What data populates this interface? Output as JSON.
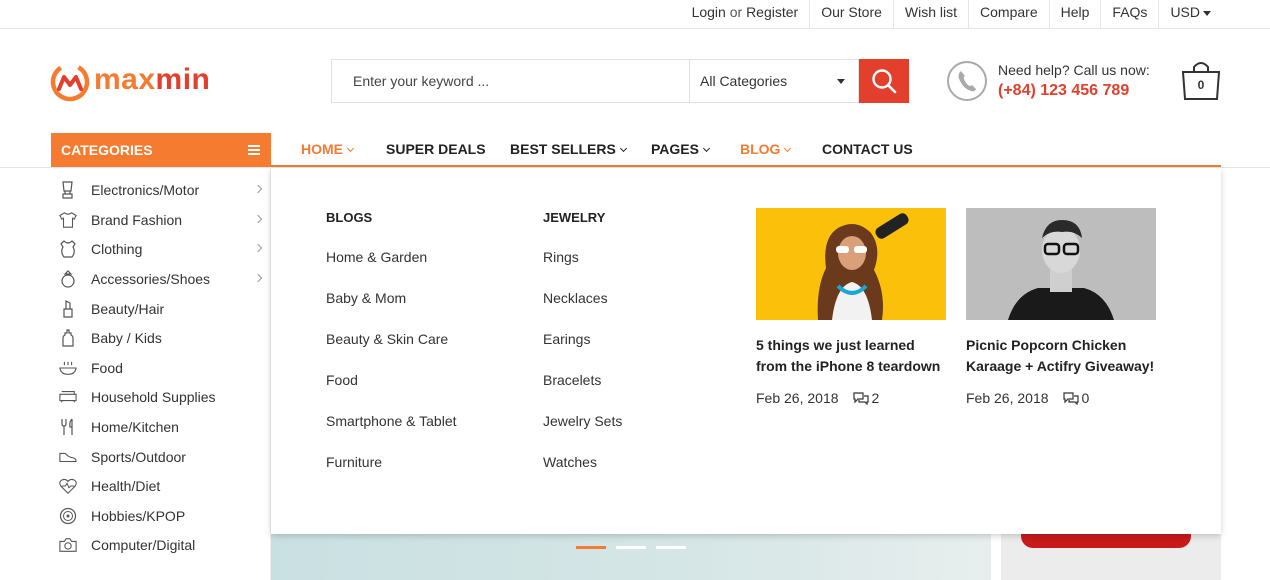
{
  "topbar": {
    "login": "Login",
    "or": "or",
    "register": "Register",
    "links": [
      "Our Store",
      "Wish list",
      "Compare",
      "Help",
      "FAQs"
    ],
    "currency": "USD"
  },
  "brand": {
    "part1": "max",
    "part2": "min",
    "primary_color": "#f47b30",
    "accent_color": "#e23f2d"
  },
  "search": {
    "placeholder": "Enter your keyword ...",
    "category": "All Categories"
  },
  "help": {
    "line1": "Need help? Call us now:",
    "phone": "(+84) 123 456 789"
  },
  "cart": {
    "count": "0"
  },
  "categories_label": "CATEGORIES",
  "menu": [
    {
      "label": "HOME",
      "active": true,
      "has_submenu": true
    },
    {
      "label": "SUPER DEALS",
      "active": false,
      "has_submenu": false
    },
    {
      "label": "BEST SELLERS",
      "active": false,
      "has_submenu": true
    },
    {
      "label": "PAGES",
      "active": false,
      "has_submenu": true
    },
    {
      "label": "BLOG",
      "active": true,
      "has_submenu": true
    },
    {
      "label": "CONTACT US",
      "active": false,
      "has_submenu": false
    }
  ],
  "sidebar": [
    {
      "label": "Electronics/Motor",
      "icon": "blender-icon",
      "has_sub": true
    },
    {
      "label": "Brand Fashion",
      "icon": "shirt-icon",
      "has_sub": true
    },
    {
      "label": "Clothing",
      "icon": "bodysuit-icon",
      "has_sub": true
    },
    {
      "label": "Accessories/Shoes",
      "icon": "ring-icon",
      "has_sub": true
    },
    {
      "label": "Beauty/Hair",
      "icon": "lipstick-icon",
      "has_sub": false
    },
    {
      "label": "Baby / Kids",
      "icon": "baby-bottle-icon",
      "has_sub": false
    },
    {
      "label": "Food",
      "icon": "food-bowl-icon",
      "has_sub": false
    },
    {
      "label": "Household Supplies",
      "icon": "sofa-icon",
      "has_sub": false
    },
    {
      "label": "Home/Kitchen",
      "icon": "utensils-icon",
      "has_sub": false
    },
    {
      "label": "Sports/Outdoor",
      "icon": "sneaker-icon",
      "has_sub": false
    },
    {
      "label": "Health/Diet",
      "icon": "heart-pulse-icon",
      "has_sub": false
    },
    {
      "label": "Hobbies/KPOP",
      "icon": "disc-icon",
      "has_sub": false
    },
    {
      "label": "Computer/Digital",
      "icon": "camera-icon",
      "has_sub": false
    }
  ],
  "dropdown": {
    "blogs": {
      "heading": "BLOGS",
      "links": [
        "Home & Garden",
        "Baby & Mom",
        "Beauty & Skin Care",
        "Food",
        "Smartphone & Tablet",
        "Furniture"
      ]
    },
    "jewelry": {
      "heading": "JEWELRY",
      "links": [
        "Rings",
        "Necklaces",
        "Earings",
        "Bracelets",
        "Jewelry Sets",
        "Watches"
      ]
    },
    "posts": [
      {
        "title": "5 things we just learned from the iPhone 8 teardown",
        "date": "Feb 26, 2018",
        "comments": "2"
      },
      {
        "title": "Picnic Popcorn Chicken Karaage + Actifry Giveaway!",
        "date": "Feb 26, 2018",
        "comments": "0"
      }
    ]
  }
}
